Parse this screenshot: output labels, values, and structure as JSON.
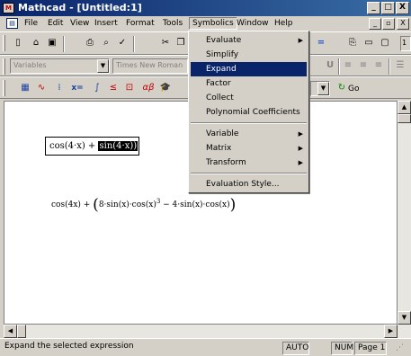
{
  "window": {
    "title": "Mathcad - [Untitled:1]",
    "app_icon": "mathcad-app-icon",
    "controls": [
      "_",
      "□",
      "X"
    ]
  },
  "menubar": {
    "doc_icon": "document-icon",
    "items": [
      "File",
      "Edit",
      "View",
      "Insert",
      "Format",
      "Tools",
      "Symbolics",
      "Window",
      "Help"
    ],
    "mdi_controls": [
      "_",
      "▫",
      "X"
    ]
  },
  "toolbar_standard": {
    "icons": [
      "new-icon",
      "open-icon",
      "save-icon",
      "print-icon",
      "print-preview-icon",
      "spell-check-icon",
      "cut-icon",
      "copy-icon"
    ],
    "zoom_partial": "1"
  },
  "toolbar_format": {
    "style_value": "Variables",
    "font_value": "Times New Roman"
  },
  "toolbar_math": {
    "icons": [
      "calculator-icon",
      "graph-icon",
      "matrix-icon",
      "evaluation-icon",
      "calculus-icon",
      "boolean-icon",
      "programming-icon",
      "greek-icon",
      "symbolic-icon"
    ],
    "go_label": "Go"
  },
  "symbolics_menu": {
    "items": [
      {
        "label": "Evaluate",
        "submenu": true
      },
      {
        "label": "Simplify",
        "submenu": false
      },
      {
        "label": "Expand",
        "submenu": false,
        "highlighted": true
      },
      {
        "label": "Factor",
        "submenu": false
      },
      {
        "label": "Collect",
        "submenu": false
      },
      {
        "label": "Polynomial Coefficients",
        "submenu": false
      },
      {
        "label": "Variable",
        "submenu": true
      },
      {
        "label": "Matrix",
        "submenu": true
      },
      {
        "label": "Transform",
        "submenu": true
      },
      {
        "label": "Evaluation Style...",
        "submenu": false
      }
    ]
  },
  "worksheet": {
    "expression_plain": "cos(4·x) + ",
    "expression_selected": "sin(4·x))",
    "result": {
      "part1": "cos(4x) + ",
      "part2": "8·sin(x)·cos(x)",
      "exponent": "3",
      "part3": " − 4·sin(x)·cos(x)"
    }
  },
  "statusbar": {
    "message": "Expand the selected expression",
    "mode": "AUTO",
    "num": "NUM",
    "page": "Page 1"
  }
}
